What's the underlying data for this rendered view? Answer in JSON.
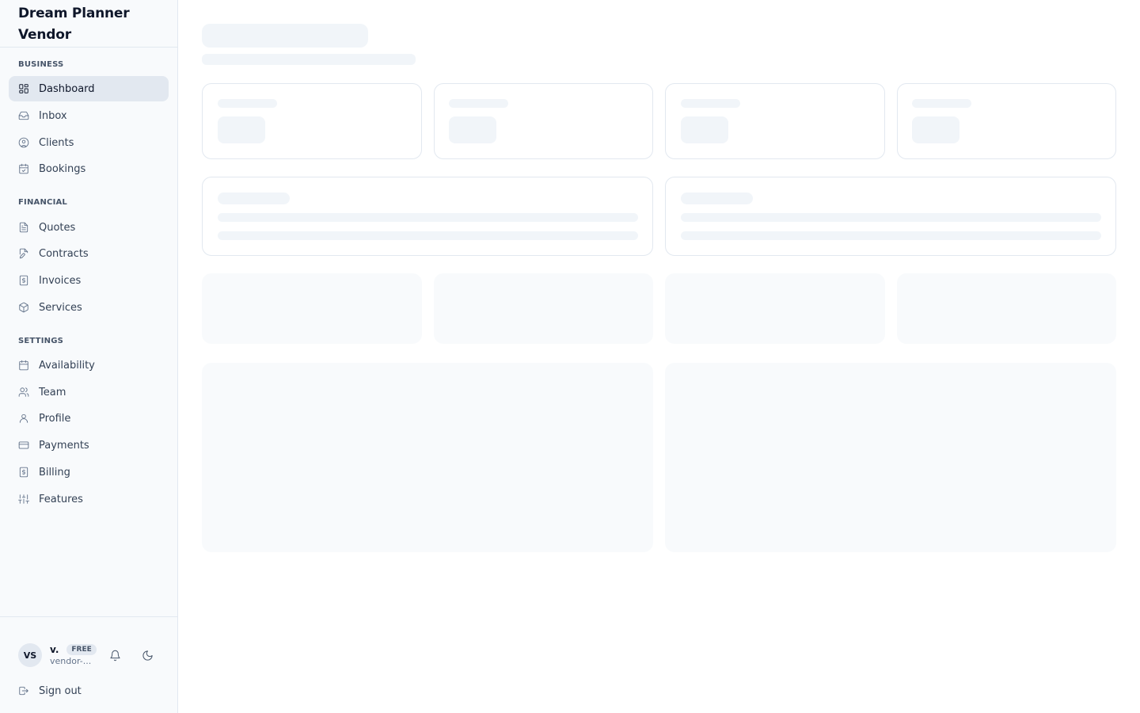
{
  "app": {
    "title": "Dream Planner Vendor"
  },
  "sidebar": {
    "sections": [
      {
        "label": "BUSINESS",
        "items": [
          {
            "label": "Dashboard",
            "icon": "dashboard-icon",
            "active": true
          },
          {
            "label": "Inbox",
            "icon": "inbox-icon"
          },
          {
            "label": "Clients",
            "icon": "user-circle-icon"
          },
          {
            "label": "Bookings",
            "icon": "calendar-check-icon"
          }
        ]
      },
      {
        "label": "FINANCIAL",
        "items": [
          {
            "label": "Quotes",
            "icon": "document-icon"
          },
          {
            "label": "Contracts",
            "icon": "document-edit-icon"
          },
          {
            "label": "Invoices",
            "icon": "receipt-dollar-icon"
          },
          {
            "label": "Services",
            "icon": "package-icon"
          }
        ]
      },
      {
        "label": "SETTINGS",
        "items": [
          {
            "label": "Availability",
            "icon": "calendar-icon"
          },
          {
            "label": "Team",
            "icon": "users-icon"
          },
          {
            "label": "Profile",
            "icon": "user-icon"
          },
          {
            "label": "Payments",
            "icon": "credit-card-icon"
          },
          {
            "label": "Billing",
            "icon": "receipt-dollar-icon"
          },
          {
            "label": "Features",
            "icon": "sliders-icon"
          }
        ]
      }
    ]
  },
  "user": {
    "initials": "VS",
    "name": "v.",
    "plan": "FREE",
    "email": "vendor-..."
  },
  "signout_label": "Sign out",
  "main": {
    "state": "loading"
  }
}
